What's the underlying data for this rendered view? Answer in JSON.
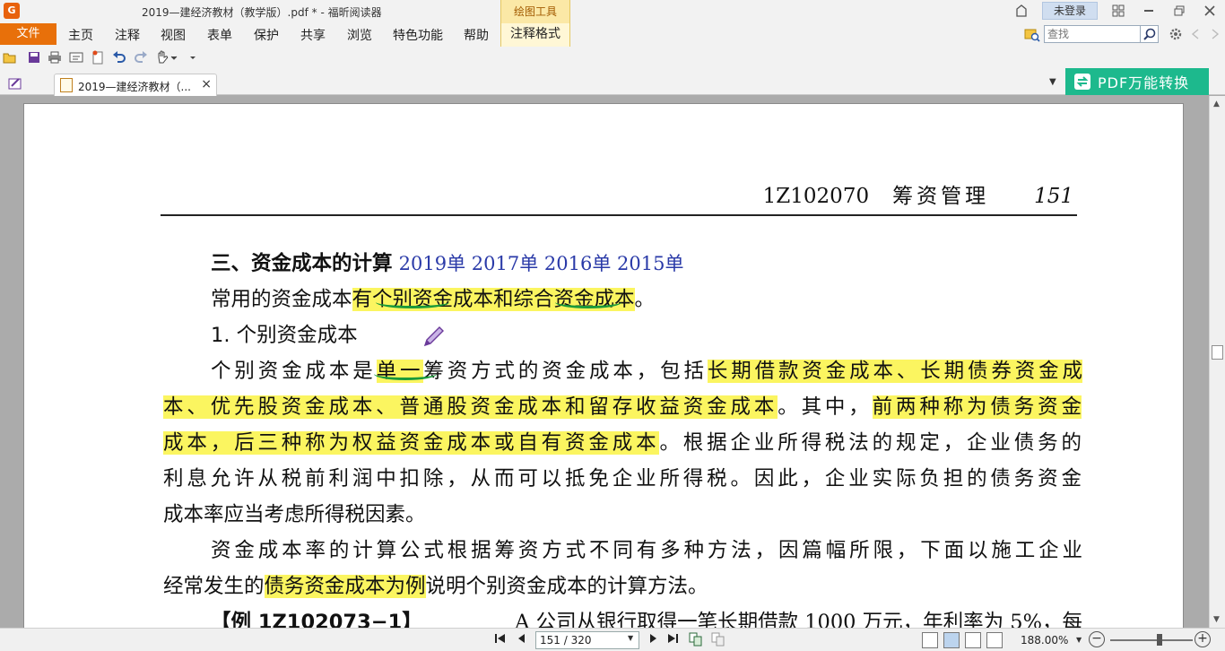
{
  "window": {
    "title": "2019—建经济教材（教学版）.pdf * - 福昕阅读器",
    "context_tab_label": "绘图工具",
    "login_label": "未登录"
  },
  "menu": {
    "file_label": "文件",
    "items": [
      "主页",
      "注释",
      "视图",
      "表单",
      "保护",
      "共享",
      "浏览",
      "特色功能",
      "帮助"
    ],
    "format_label": "注释格式"
  },
  "search": {
    "placeholder": "查找",
    "value": ""
  },
  "tab": {
    "title": "2019—建经济教材（...",
    "close_symbol": "×"
  },
  "convert_button": {
    "label": "PDF万能转换"
  },
  "page": {
    "header": {
      "code": "1Z102070",
      "title": "筹资管理",
      "page_number": "151"
    },
    "section_title": "三、资金成本的计算",
    "years": "2019单   2017单   2016单   2015单",
    "para1": {
      "plain": "常用的资金成本",
      "highlight": "有个别资金成本和综合资金成本",
      "end": "。"
    },
    "subtitle": "1. 个别资金成本",
    "para2": {
      "l1_plain": "个别资金成本是",
      "l1_hl1": "单一",
      "l1_mid": "筹资方式的资金成本，包括",
      "l1_hl2": "长期借款资金成本、长期债券资金成",
      "l2_hl": "本、优先股资金成本、普通股资金成本和留存收益资金成本",
      "l2_mid": "。其中，",
      "l2_hl2": "前两种称为债务资金",
      "l3_hl": "成本，后三种称为权益资金成本或自有资金成本",
      "l3_mid": "。根据企业所得税法的规定，企业债务的",
      "l4": "利息允许从税前利润中扣除，从而可以抵免企业所得税。因此，企业实际负担的债务资金",
      "l5": "成本率应当考虑所得税因素。"
    },
    "para3": {
      "l1": "资金成本率的计算公式根据筹资方式不同有多种方法，因篇幅所限，下面以施工企业",
      "l2_plain": "经常发生的",
      "l2_hl": "债务资金成本为例",
      "l2_end": "说明个别资金成本的计算方法。"
    },
    "example": {
      "label": "【例 1Z102073−1】",
      "text": "A 公司从银行取得一笔长期借款 1000 万元，年利率为 5%，每"
    },
    "highlight_color": "#fbf560",
    "ink_color": "#1a9a3a"
  },
  "status": {
    "page_field": "151 / 320",
    "zoom": "188.00%"
  },
  "icons": {
    "title": [
      "app-logo-icon"
    ],
    "quick": [
      "open-icon",
      "save-icon",
      "print-icon",
      "properties-icon",
      "new-icon",
      "undo-icon",
      "redo-icon",
      "hand-tool-icon"
    ],
    "right": [
      "skin-icon",
      "layout-icon",
      "minimize-icon",
      "restore-icon",
      "close-icon",
      "settings-icon",
      "back-icon",
      "forward-icon"
    ]
  }
}
